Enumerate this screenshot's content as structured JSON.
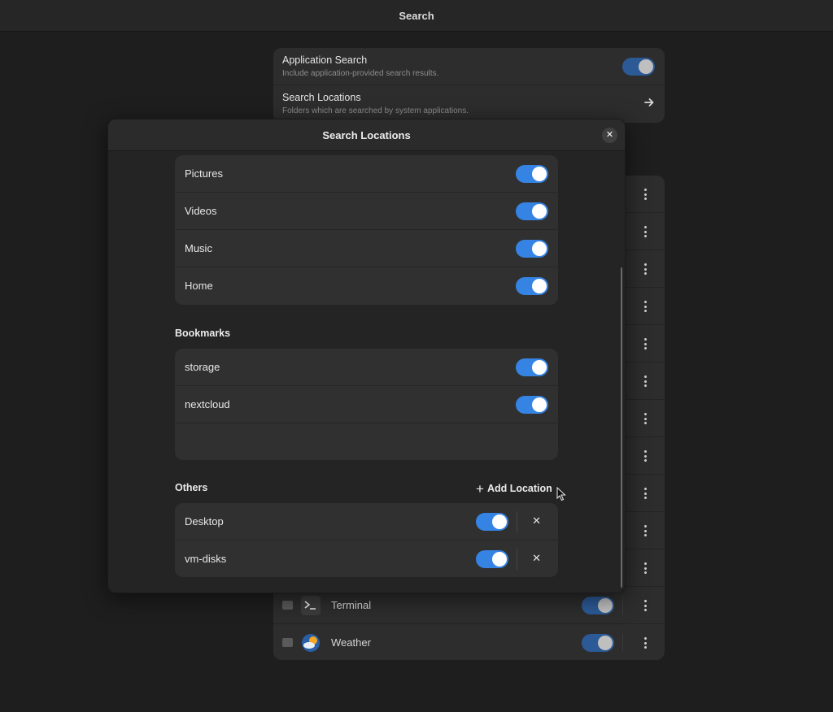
{
  "window": {
    "title": "Search"
  },
  "settings_top": {
    "application_search": {
      "title": "Application Search",
      "subtitle": "Include application-provided search results."
    },
    "search_locations": {
      "title": "Search Locations",
      "subtitle": "Folders which are searched by system applications."
    }
  },
  "bg_apps": [
    {
      "name": "Terminal",
      "icon": "terminal-icon"
    },
    {
      "name": "Weather",
      "icon": "weather-icon"
    }
  ],
  "dialog": {
    "title": "Search Locations",
    "places": [
      {
        "label": "Pictures",
        "enabled": true
      },
      {
        "label": "Videos",
        "enabled": true
      },
      {
        "label": "Music",
        "enabled": true
      },
      {
        "label": "Home",
        "enabled": true
      }
    ],
    "bookmarks_title": "Bookmarks",
    "bookmarks": [
      {
        "label": "storage",
        "enabled": true
      },
      {
        "label": "nextcloud",
        "enabled": true
      }
    ],
    "others_title": "Others",
    "add_location_label": "Add Location",
    "others": [
      {
        "label": "Desktop",
        "enabled": true
      },
      {
        "label": "vm-disks",
        "enabled": true
      }
    ]
  },
  "colors": {
    "accent": "#3584e4",
    "window_bg": "#1e1e1e",
    "card_bg": "#303030"
  }
}
